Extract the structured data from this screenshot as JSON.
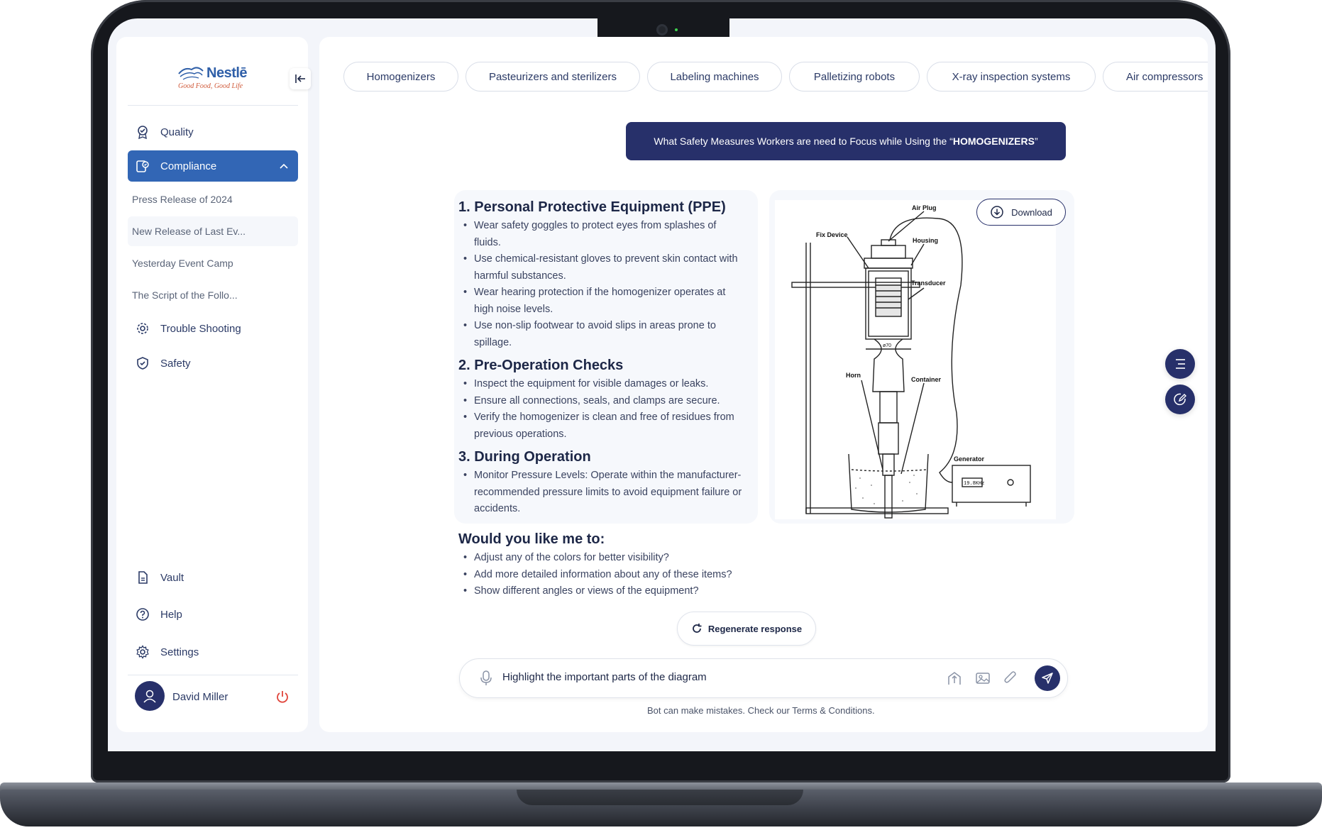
{
  "brand": {
    "name": "Nestlē",
    "tagline": "Good Food, Good Life"
  },
  "sidebar": {
    "items": [
      {
        "label": "Quality",
        "icon": "badge-icon"
      },
      {
        "label": "Compliance",
        "icon": "compliance-icon",
        "active": true
      },
      {
        "label": "Trouble Shooting",
        "icon": "gear-icon"
      },
      {
        "label": "Safety",
        "icon": "shield-icon"
      }
    ],
    "subitems": [
      "Press Release of 2024",
      "New Release of Last Ev...",
      "Yesterday Event Camp",
      "The Script of the Follo..."
    ],
    "bottom": [
      {
        "label": "Vault",
        "icon": "document-icon"
      },
      {
        "label": "Help",
        "icon": "help-icon"
      },
      {
        "label": "Settings",
        "icon": "settings-icon"
      }
    ],
    "user": {
      "name": "David Miller"
    }
  },
  "chips": [
    "Homogenizers",
    "Pasteurizers and sterilizers",
    "Labeling machines",
    "Palletizing robots",
    "X-ray inspection systems",
    "Air compressors"
  ],
  "query": {
    "prefix": "What Safety Measures Workers are need to Focus while Using the “",
    "highlight": "HOMOGENIZERS",
    "suffix": "”"
  },
  "answer": {
    "sections": [
      {
        "title": "1. Personal Protective Equipment (PPE)",
        "items": [
          "Wear safety goggles to protect eyes from splashes of fluids.",
          "Use chemical-resistant gloves to prevent skin contact with harmful substances.",
          "Wear hearing protection if the homogenizer operates at high noise levels.",
          "Use non-slip footwear to avoid slips in areas prone to spillage."
        ]
      },
      {
        "title": "2. Pre-Operation Checks",
        "items": [
          "Inspect the equipment for visible damages or leaks.",
          "Ensure all connections, seals, and clamps are secure.",
          "Verify the homogenizer is clean and free of residues from previous operations."
        ]
      },
      {
        "title": "3. During Operation",
        "items": [
          "Monitor Pressure Levels: Operate within the manufacturer-recommended pressure limits to avoid equipment failure or accidents."
        ]
      }
    ],
    "followup": {
      "title": "Would you like me to:",
      "items": [
        "Adjust any of the colors for better visibility?",
        "Add more detailed information about any of these items?",
        "Show different angles or views of the equipment?"
      ]
    }
  },
  "diagram": {
    "download_label": "Download",
    "labels": {
      "air_plug": "Air Plug",
      "fix_device": "Fix Device",
      "housing": "Housing",
      "transducer": "Transducer",
      "horn": "Horn",
      "container": "Container",
      "generator": "Generator",
      "readout": "19.8KHz",
      "dim": "ø70"
    }
  },
  "regenerate_label": "Regenerate response",
  "input": {
    "value": "Highlight the important parts of the diagram"
  },
  "disclaimer": "Bot can make mistakes. Check our Terms & Conditions."
}
